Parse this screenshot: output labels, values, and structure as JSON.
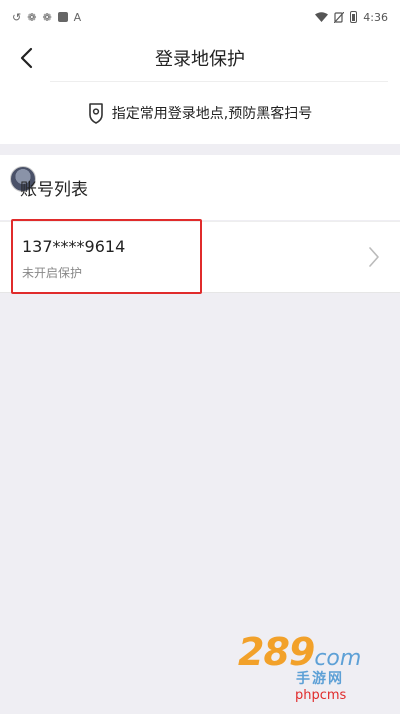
{
  "status_bar": {
    "left_icons": [
      "sync-icon",
      "bug-icon",
      "bug-icon",
      "square-app-icon",
      "a-app-icon"
    ],
    "time": "4:36"
  },
  "navbar": {
    "title": "登录地保护"
  },
  "tip": {
    "text": "指定常用登录地点,预防黑客扫号"
  },
  "accounts_section": {
    "title": "账号列表",
    "items": [
      {
        "phone": "137****9614",
        "status": "未开启保护"
      }
    ]
  },
  "watermark": {
    "number": "289",
    "suffix": "com",
    "subtitle": "手游网",
    "footer": "phpcms"
  },
  "colors": {
    "highlight": "#e02b2b",
    "background": "#efeef3",
    "watermark_orange": "#f2a12a",
    "watermark_blue": "#5da0d6"
  }
}
